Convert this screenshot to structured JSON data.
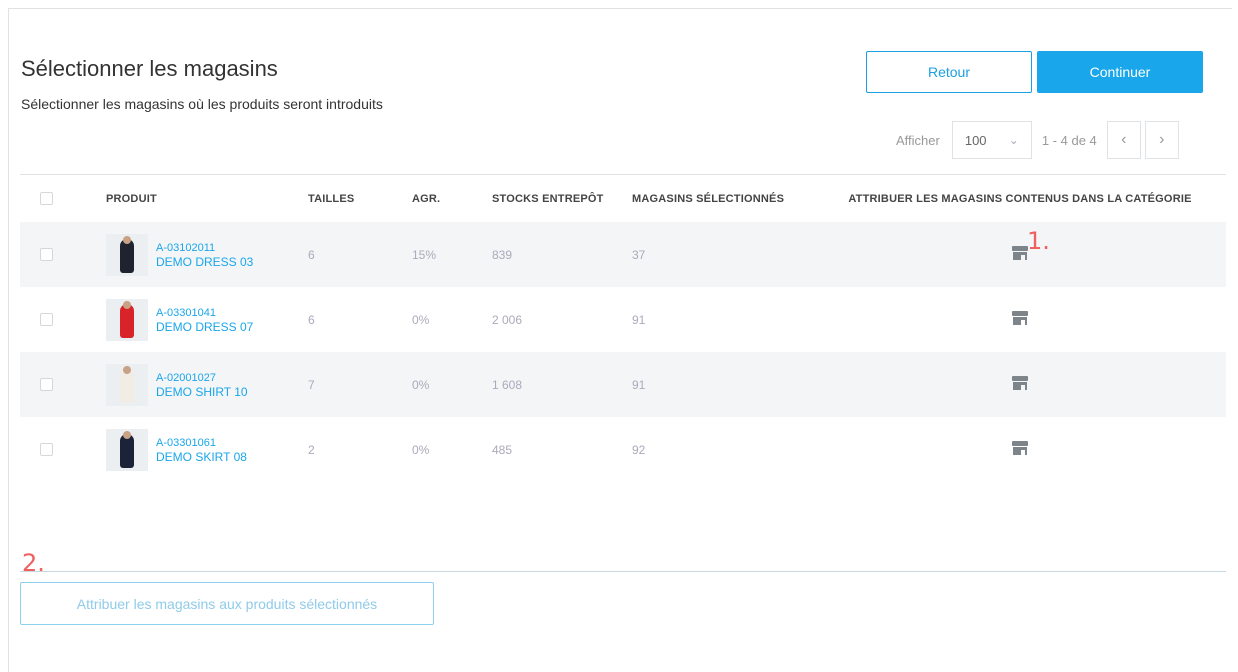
{
  "header": {
    "title": "Sélectionner les magasins",
    "subtitle": "Sélectionner les magasins où les produits seront introduits",
    "back_label": "Retour",
    "continue_label": "Continuer"
  },
  "pager": {
    "show_label": "Afficher",
    "page_size": "100",
    "range": "1 - 4 de 4"
  },
  "columns": {
    "product": "PRODUIT",
    "sizes": "TAILLES",
    "agr": "AGR.",
    "stock": "STOCKS ENTREPÔT",
    "selected_stores": "MAGASINS SÉLECTIONNÉS",
    "assign": "ATTRIBUER LES MAGASINS CONTENUS DANS LA CATÉGORIE"
  },
  "rows": [
    {
      "code": "A-03102011",
      "name": "DEMO DRESS 03",
      "sizes": "6",
      "agr": "15%",
      "stock": "839",
      "stores": "37",
      "color": "#1f2330"
    },
    {
      "code": "A-03301041",
      "name": "DEMO DRESS 07",
      "sizes": "6",
      "agr": "0%",
      "stock": "2 006",
      "stores": "91",
      "color": "#d8232a"
    },
    {
      "code": "A-02001027",
      "name": "DEMO SHIRT 10",
      "sizes": "7",
      "agr": "0%",
      "stock": "1 608",
      "stores": "91",
      "color": "#f1ece4"
    },
    {
      "code": "A-03301061",
      "name": "DEMO SKIRT 08",
      "sizes": "2",
      "agr": "0%",
      "stock": "485",
      "stores": "92",
      "color": "#1c2238"
    }
  ],
  "annotations": {
    "one": "1.",
    "two": "2."
  },
  "footer": {
    "assign_label": "Attribuer les magasins aux produits sélectionnés"
  },
  "colors": {
    "accent": "#1aa6ea",
    "annotation": "#f06060",
    "row_alt": "#f3f5f7"
  },
  "icons": {
    "store": "store-icon",
    "checkbox": "checkbox-icon"
  }
}
